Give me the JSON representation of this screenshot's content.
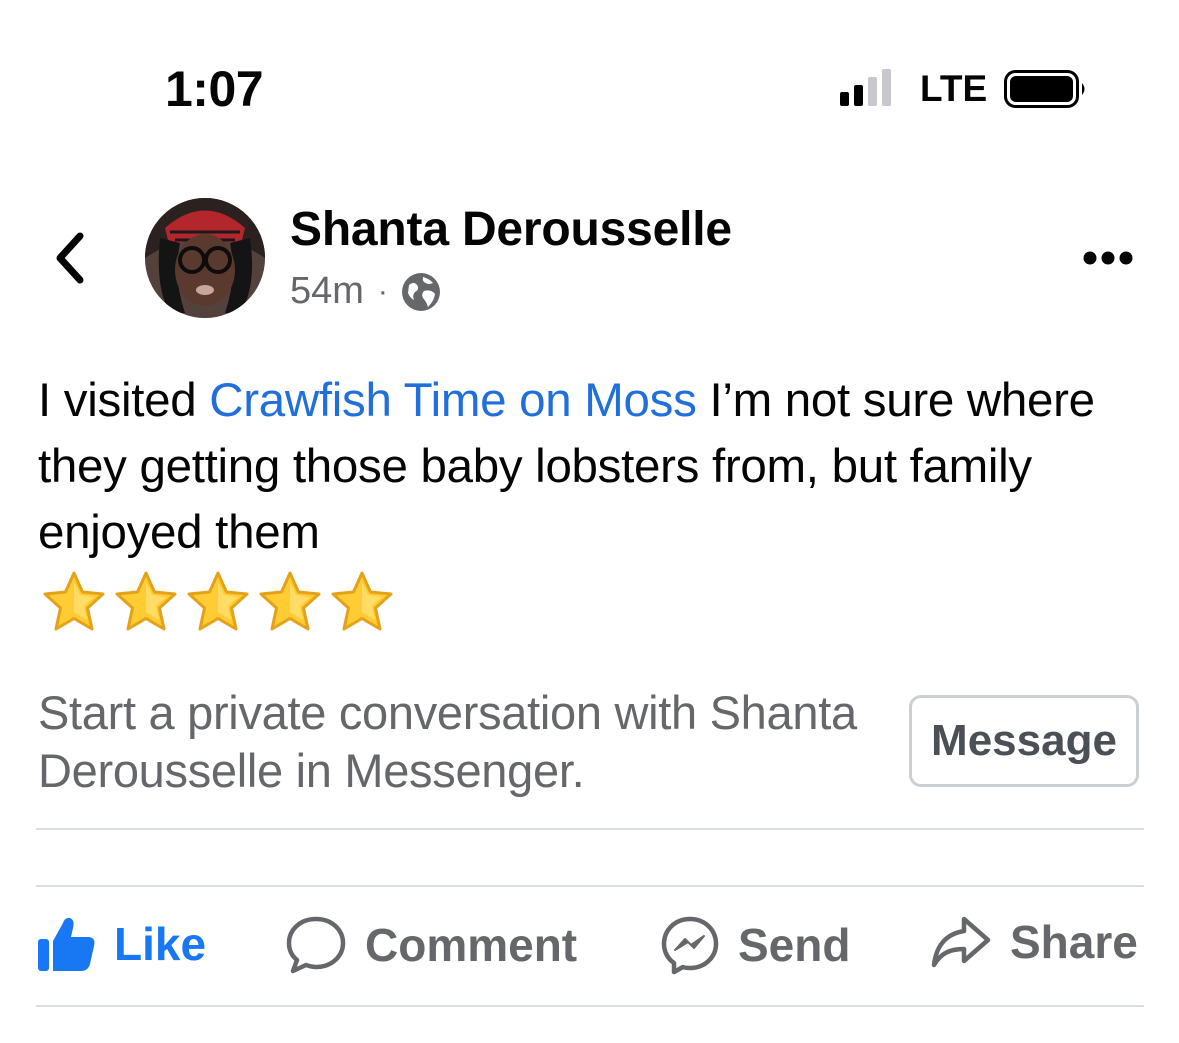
{
  "status_bar": {
    "time": "1:07",
    "network": "LTE"
  },
  "header": {
    "author": "Shanta Derousselle",
    "timestamp": "54m",
    "separator": "·",
    "privacy_icon": "globe-icon",
    "back_icon": "chevron-left-icon",
    "more_icon": "more-horizontal-icon"
  },
  "post": {
    "text_before": "I visited ",
    "place_link": "Crawfish Time on Moss",
    "text_after": " I’m not sure where they getting those baby lobsters from, but family enjoyed them",
    "star_count": 5
  },
  "messenger_prompt": {
    "text": "Start a private conversation with Shanta Derousselle in Messenger.",
    "button_label": "Message"
  },
  "actions": [
    {
      "label": "Like",
      "icon": "thumbs-up-icon"
    },
    {
      "label": "Comment",
      "icon": "comment-icon"
    },
    {
      "label": "Send",
      "icon": "messenger-icon"
    },
    {
      "label": "Share",
      "icon": "share-icon"
    }
  ],
  "colors": {
    "link": "#216fdb",
    "like_blue": "#1877f2",
    "secondary_text": "#65676b",
    "divider": "#dadde1"
  }
}
